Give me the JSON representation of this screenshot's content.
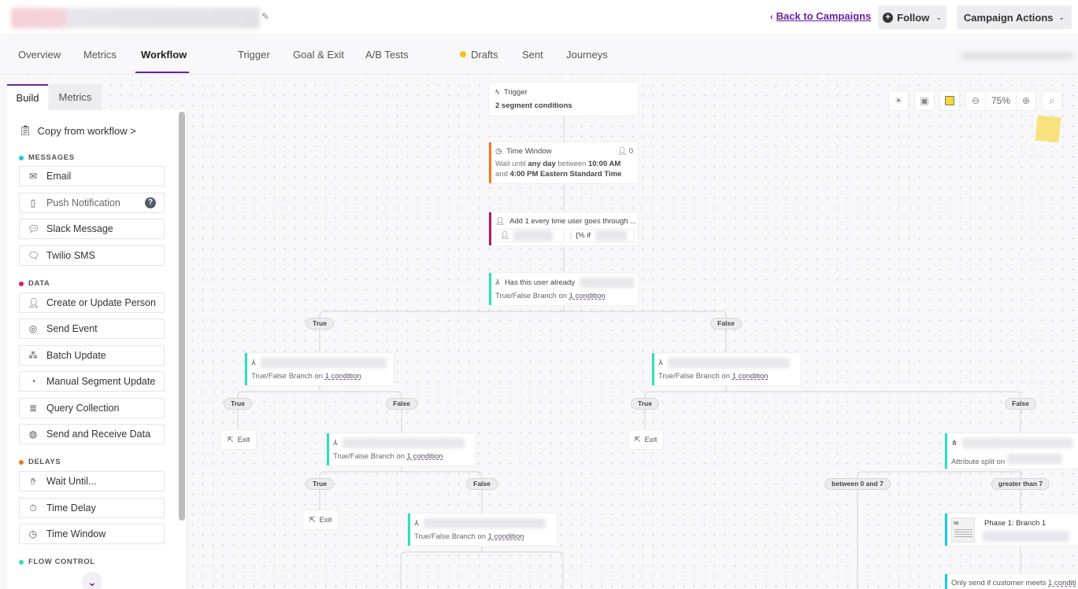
{
  "header": {
    "back_link": "Back to Campaigns",
    "follow_label": "Follow",
    "actions_label": "Campaign Actions"
  },
  "tabs": [
    {
      "label": "Overview"
    },
    {
      "label": "Metrics"
    },
    {
      "label": "Workflow",
      "active": true
    },
    {
      "label": "Trigger"
    },
    {
      "label": "Goal & Exit"
    },
    {
      "label": "A/B Tests"
    },
    {
      "label": "Drafts",
      "indicator_color": "#f2c31b"
    },
    {
      "label": "Sent"
    },
    {
      "label": "Journeys"
    }
  ],
  "panel": {
    "tabs": [
      "Build",
      "Metrics"
    ],
    "copy_label": "Copy from workflow >",
    "sections": [
      {
        "label": "MESSAGES",
        "color": "#1ec8e8",
        "items": [
          {
            "label": "Email",
            "icon": "envelope-icon"
          },
          {
            "label": "Push Notification",
            "icon": "phone-icon",
            "help": "?"
          },
          {
            "label": "Slack Message",
            "icon": "chat-bubble-icon"
          },
          {
            "label": "Twilio SMS",
            "icon": "sms-bubble-icon"
          }
        ]
      },
      {
        "label": "DATA",
        "color": "#e0176d",
        "items": [
          {
            "label": "Create or Update Person",
            "icon": "person-edit-icon"
          },
          {
            "label": "Send Event",
            "icon": "cursor-click-icon"
          },
          {
            "label": "Batch Update",
            "icon": "people-group-icon"
          },
          {
            "label": "Manual Segment Update",
            "icon": "gauge-icon"
          },
          {
            "label": "Query Collection",
            "icon": "database-search-icon"
          },
          {
            "label": "Send and Receive Data",
            "icon": "globe-icon"
          }
        ]
      },
      {
        "label": "DELAYS",
        "color": "#f07a1b",
        "items": [
          {
            "label": "Wait Until...",
            "icon": "hand-icon"
          },
          {
            "label": "Time Delay",
            "icon": "stopwatch-icon"
          },
          {
            "label": "Time Window",
            "icon": "clock-icon"
          }
        ]
      },
      {
        "label": "FLOW CONTROL",
        "color": "#2ee0b6",
        "items": []
      }
    ]
  },
  "toolbar": {
    "zoom_level": "75%"
  },
  "workflow": {
    "trigger": {
      "title": "Trigger",
      "detail": "2 segment conditions"
    },
    "time_window": {
      "title": "Time Window",
      "count": "0",
      "pre": "Wait until ",
      "b1": "any day",
      "mid": " between ",
      "b2": "10:00 AM",
      "and": "and ",
      "b3": "4:00 PM Eastern Standard Time"
    },
    "update_attr": {
      "title": "Add 1 every time user goes through ...",
      "value_prefix": "{% if"
    },
    "branch_main": {
      "title": "Has this user already",
      "sub": "True/False Branch on ",
      "cond": "1 condition"
    },
    "branch_sub": "True/False Branch on ",
    "cond_label": "1 condition",
    "true_label": "True",
    "false_label": "False",
    "exit_label": "Exit",
    "attr_split": "Attribute split on",
    "split_a": "between 0 and 7",
    "split_b": "greater than 7",
    "phase_title": "Phase 1: Branch 1",
    "send_if": "Only send if customer meets ",
    "send_if_cond": "1 conditi"
  },
  "colors": {
    "accent": "#6b1fa6",
    "branch": "#2ee0b6",
    "delay": "#f07a1b",
    "data": "#b8195f",
    "message": "#1ec8e8"
  }
}
